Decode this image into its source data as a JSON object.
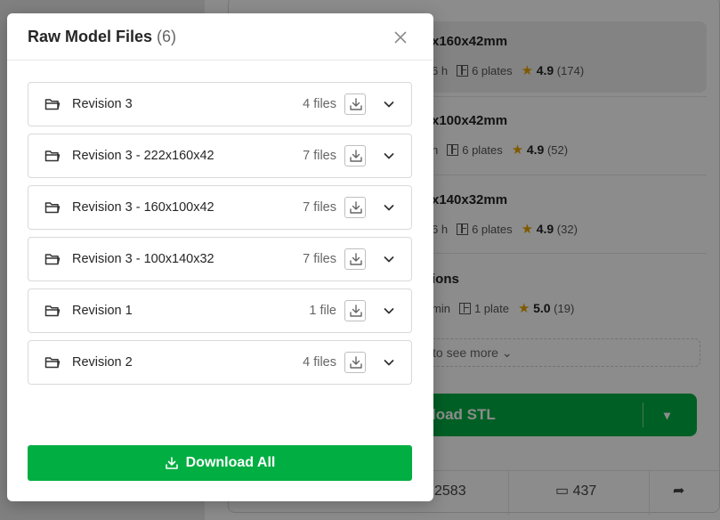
{
  "background": {
    "plates": [
      {
        "title": "x160x42mm",
        "time": "6 h",
        "plates": "6 plates",
        "rating": "4.9",
        "reviews": "(174)",
        "active": true
      },
      {
        "title": "x100x42mm",
        "time": "h",
        "plates": "6 plates",
        "rating": "4.9",
        "reviews": "(52)",
        "active": false
      },
      {
        "title": "x140x32mm",
        "time": "6 h",
        "plates": "6 plates",
        "rating": "4.9",
        "reviews": "(32)",
        "active": false
      },
      {
        "title": "ions",
        "time": "min",
        "plates": "1 plate",
        "rating": "5.0",
        "reviews": "(19)",
        "active": false
      }
    ],
    "see_more": "to see more",
    "download_stl": "load STL",
    "stats": {
      "likes": "2583",
      "comments": "437"
    }
  },
  "modal": {
    "title": "Raw Model Files",
    "count": "(6)",
    "folders": [
      {
        "name": "Revision 3",
        "count": "4 files"
      },
      {
        "name": "Revision 3 - 222x160x42",
        "count": "7 files"
      },
      {
        "name": "Revision 3 - 160x100x42",
        "count": "7 files"
      },
      {
        "name": "Revision 3 - 100x140x32",
        "count": "7 files"
      },
      {
        "name": "Revision 1",
        "count": "1 file"
      },
      {
        "name": "Revision 2",
        "count": "4 files"
      }
    ],
    "download_all": "Download All"
  },
  "colors": {
    "accent": "#00ae42",
    "star": "#e8a300"
  },
  "icons": [
    "close-icon",
    "folder-icon",
    "download-icon",
    "chevron-down-icon",
    "star-icon",
    "plates-icon",
    "comment-icon",
    "share-icon"
  ]
}
